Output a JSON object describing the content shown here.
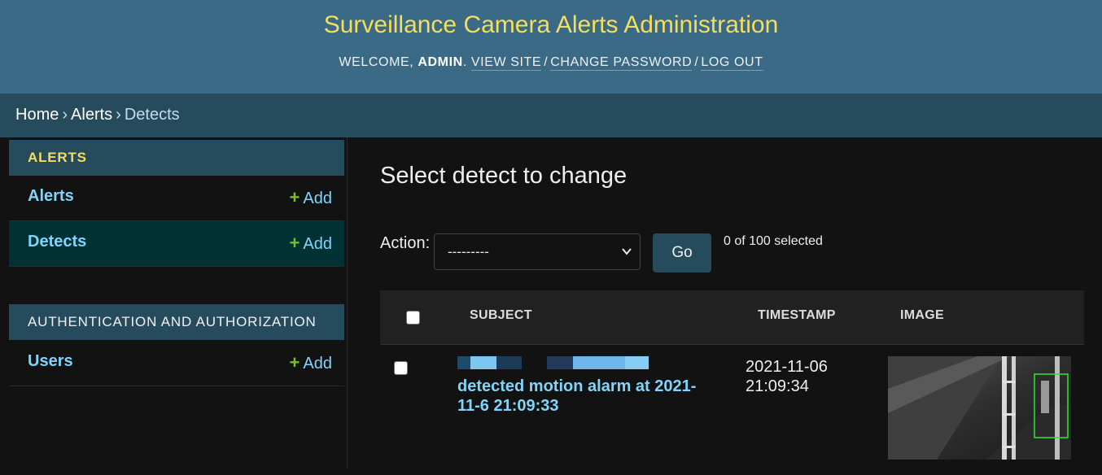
{
  "header": {
    "title": "Surveillance Camera Alerts Administration",
    "welcome": "Welcome,",
    "username": "admin",
    "view_site": "View site",
    "change_password": "Change password",
    "log_out": "Log out"
  },
  "breadcrumbs": {
    "home": "Home",
    "alerts": "Alerts",
    "current": "Detects",
    "separator": "›"
  },
  "sidebar": {
    "modules": [
      {
        "caption": "Alerts",
        "models": [
          {
            "name": "Alerts",
            "add_label": "Add",
            "current": false
          },
          {
            "name": "Detects",
            "add_label": "Add",
            "current": true
          }
        ]
      },
      {
        "caption": "Authentication and Authorization",
        "models": [
          {
            "name": "Users",
            "add_label": "Add",
            "current": false
          }
        ]
      }
    ]
  },
  "content": {
    "title": "Select detect to change",
    "action_label": "Action:",
    "action_selected": "---------",
    "go_label": "Go",
    "selected_count": "0 of 100 selected",
    "columns": [
      "Subject",
      "Timestamp",
      "Image"
    ],
    "rows": [
      {
        "subject": "detected motion alarm at 2021-11-6 21:09:33",
        "timestamp": "2021-11-06 21:09:34",
        "image_icon": "camera-snapshot-thumbnail"
      }
    ]
  },
  "colors": {
    "header_bg": "#3a6a85",
    "title": "#f5dd5d",
    "breadcrumb_bg": "#264b5d",
    "link": "#81d4fa",
    "add_plus": "#70bf2b",
    "body_bg": "#121212",
    "current_row": "#003135"
  }
}
